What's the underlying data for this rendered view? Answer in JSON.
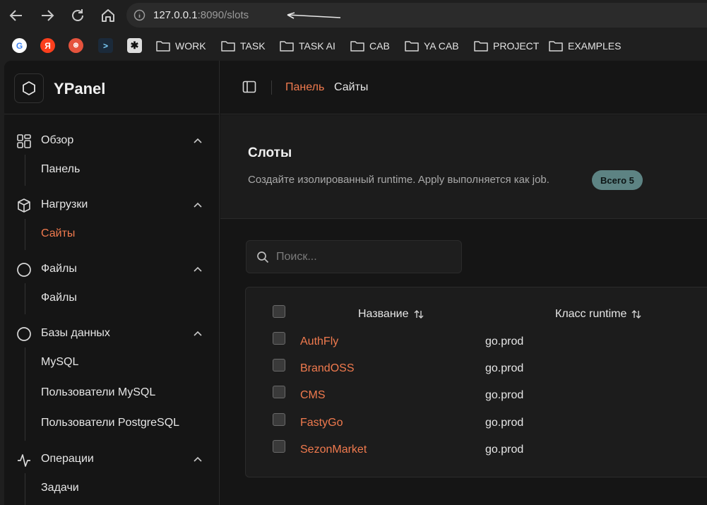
{
  "browser": {
    "url_host": "127.0.0.1",
    "url_rest": ":8090/slots",
    "bookmarks": [
      "WORK",
      "TASK",
      "TASK AI",
      "CAB",
      "YA CAB",
      "PROJECT",
      "EXAMPLES"
    ]
  },
  "brand": {
    "name": "YPanel"
  },
  "sidebar": {
    "groups": [
      {
        "label": "Обзор",
        "icon": "grid-icon",
        "items": [
          "Панель"
        ]
      },
      {
        "label": "Нагрузки",
        "icon": "cube-icon",
        "items": [
          "Сайты"
        ]
      },
      {
        "label": "Файлы",
        "icon": "circle-icon",
        "items": [
          "Файлы"
        ]
      },
      {
        "label": "Базы данных",
        "icon": "circle-icon",
        "items": [
          "MySQL",
          "Пользователи MySQL",
          "Пользователи PostgreSQL"
        ]
      },
      {
        "label": "Операции",
        "icon": "activity-icon",
        "items": [
          "Задачи"
        ]
      }
    ],
    "active_item": "Сайты"
  },
  "breadcrumb": {
    "parent": "Панель",
    "current": "Сайты"
  },
  "header": {
    "title": "Слоты",
    "description": "Создайте изолированный runtime. Apply выполняется как job.",
    "total_badge": "Всего 5"
  },
  "search": {
    "placeholder": "Поиск..."
  },
  "table": {
    "columns": [
      "Название",
      "Класс runtime"
    ],
    "rows": [
      {
        "name": "AuthFly",
        "runtime_class": "go.prod"
      },
      {
        "name": "BrandOSS",
        "runtime_class": "go.prod"
      },
      {
        "name": "CMS",
        "runtime_class": "go.prod"
      },
      {
        "name": "FastyGo",
        "runtime_class": "go.prod"
      },
      {
        "name": "SezonMarket",
        "runtime_class": "go.prod"
      }
    ]
  },
  "colors": {
    "accent": "#f07a4e",
    "badge_bg": "#5d8383",
    "background": "#151515"
  }
}
